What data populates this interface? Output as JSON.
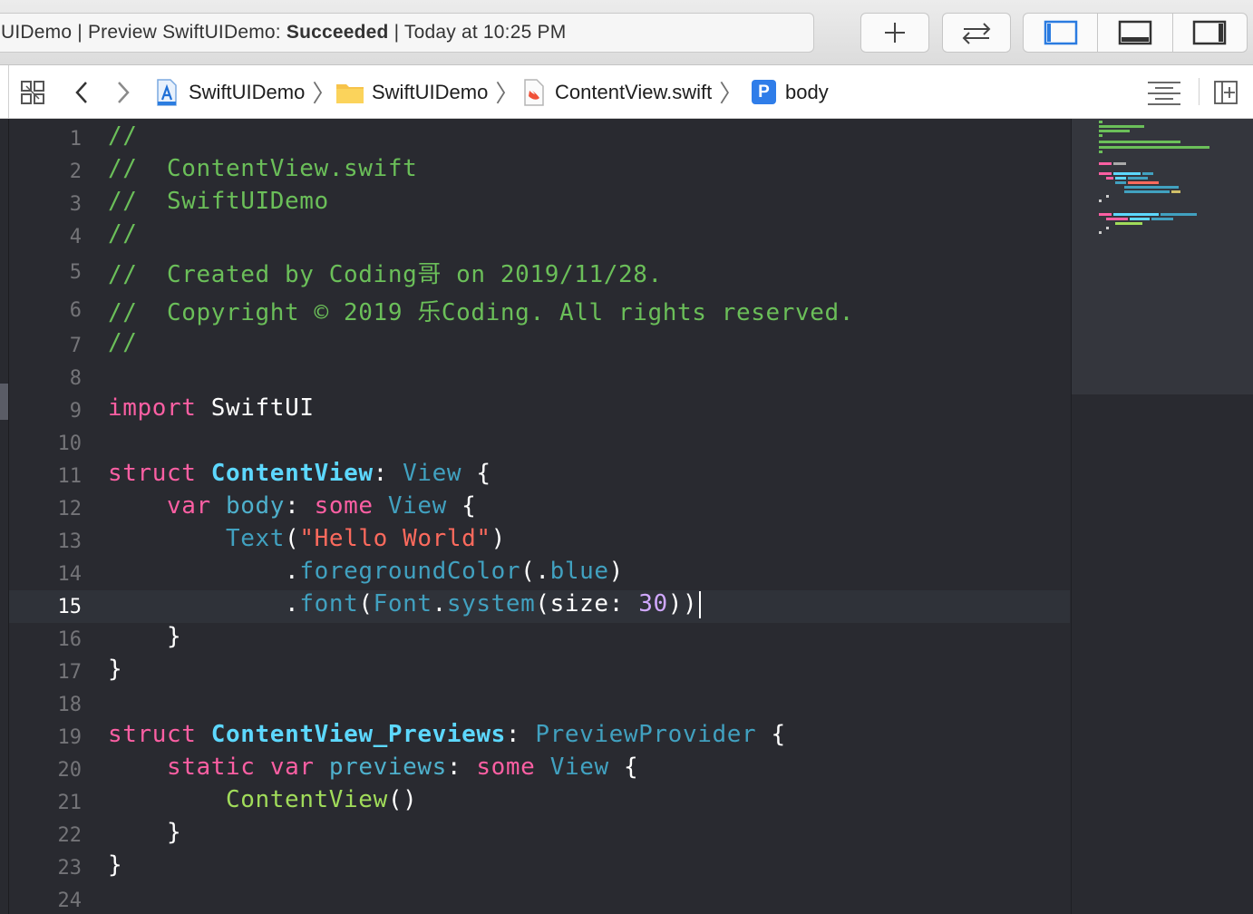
{
  "toolbar": {
    "status_prefix": "UIDemo | Preview SwiftUIDemo: ",
    "status_result": "Succeeded",
    "status_suffix": " | Today at 10:25 PM",
    "add_icon": "plus-icon",
    "swap_icon": "swap-arrows-icon",
    "panel_icons": [
      "navigator-panel-icon",
      "debug-panel-icon",
      "inspector-panel-icon"
    ]
  },
  "jumpbar": {
    "breadcrumbs": [
      {
        "label": "SwiftUIDemo",
        "icon": "xcode-project-icon"
      },
      {
        "label": "SwiftUIDemo",
        "icon": "folder-icon"
      },
      {
        "label": "ContentView.swift",
        "icon": "swift-file-icon"
      },
      {
        "label": "body",
        "icon": "property-icon",
        "badge": "P"
      }
    ],
    "icons": [
      "related-items-icon",
      "back-arrow-icon",
      "forward-arrow-icon",
      "editor-options-icon",
      "add-editor-icon"
    ]
  },
  "editor": {
    "current_line": 15,
    "line_numbers": [
      "1",
      "2",
      "3",
      "4",
      "5",
      "6",
      "7",
      "8",
      "9",
      "10",
      "11",
      "12",
      "13",
      "14",
      "15",
      "16",
      "17",
      "18",
      "19",
      "20",
      "21",
      "22",
      "23",
      "24"
    ],
    "lines": [
      "//",
      "//  ContentView.swift",
      "//  SwiftUIDemo",
      "//",
      "//  Created by Coding哥 on 2019/11/28.",
      "//  Copyright © 2019 乐Coding. All rights reserved.",
      "//",
      "",
      "import SwiftUI",
      "",
      "struct ContentView: View {",
      "    var body: some View {",
      "        Text(\"Hello World\")",
      "            .foregroundColor(.blue)",
      "            .font(Font.system(size: 30))",
      "    }",
      "}",
      "",
      "struct ContentView_Previews: PreviewProvider {",
      "    static var previews: some View {",
      "        ContentView()",
      "    }",
      "}",
      ""
    ]
  },
  "colors": {
    "background": "#292a30",
    "comment": "#6bbf59",
    "keyword": "#fc5fa3",
    "type_declaration": "#5dd8ff",
    "system_type": "#41a1c0",
    "string": "#fc6a5d",
    "number": "#d0bf69"
  }
}
